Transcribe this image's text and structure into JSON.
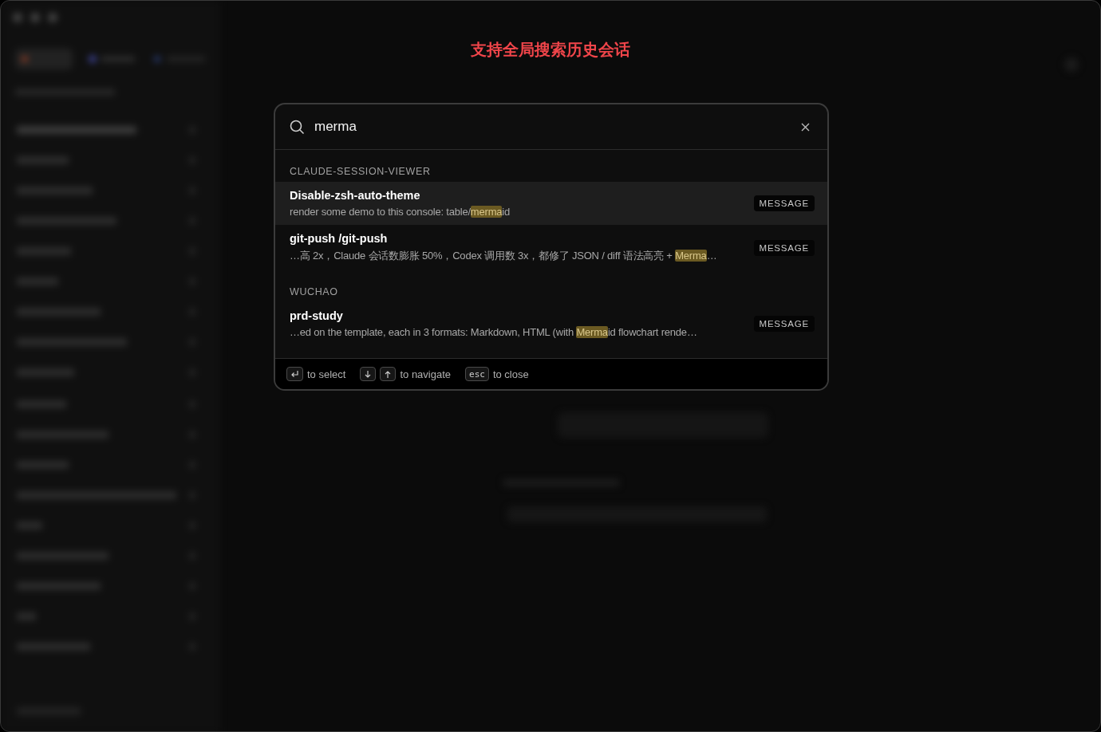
{
  "banner": "支持全局搜索历史会话",
  "search": {
    "value": "merma"
  },
  "groups": [
    {
      "name": "CLAUDE-SESSION-VIEWER",
      "results": [
        {
          "title": "Disable-zsh-auto-theme",
          "before": "render some demo to this console: table/",
          "match": "merma",
          "after": "id",
          "badge": "MESSAGE",
          "selected": true
        },
        {
          "title": "git-push /git-push",
          "before": "…高 2x，Claude 会话数膨胀 50%，Codex 调用数 3x，都修了 JSON / diff 语法高亮 + ",
          "match": "Merma",
          "after": "…",
          "badge": "MESSAGE",
          "selected": false
        }
      ]
    },
    {
      "name": "WUCHAO",
      "results": [
        {
          "title": "prd-study",
          "before": "…ed on the template, each in 3 formats: Markdown, HTML (with ",
          "match": "Merma",
          "after": "id flowchart rende…",
          "badge": "MESSAGE",
          "selected": false
        }
      ]
    }
  ],
  "footer": [
    {
      "keys": [
        {
          "kind": "enter"
        }
      ],
      "label": "to select"
    },
    {
      "keys": [
        {
          "kind": "down"
        },
        {
          "kind": "up"
        }
      ],
      "label": "to navigate"
    },
    {
      "keys": [
        {
          "kind": "text",
          "text": "esc"
        }
      ],
      "label": "to close"
    }
  ]
}
